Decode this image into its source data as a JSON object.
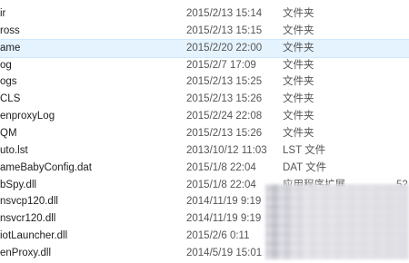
{
  "file_list": {
    "rows": [
      {
        "name": "ir",
        "date": "2015/2/13 15:14",
        "type": "文件夹",
        "size": "",
        "selected": false
      },
      {
        "name": "ross",
        "date": "2015/2/13 15:15",
        "type": "文件夹",
        "size": "",
        "selected": false
      },
      {
        "name": "ame",
        "date": "2015/2/20 22:00",
        "type": "文件夹",
        "size": "",
        "selected": true
      },
      {
        "name": "og",
        "date": "2015/2/7 17:09",
        "type": "文件夹",
        "size": "",
        "selected": false
      },
      {
        "name": "ogs",
        "date": "2015/2/13 15:25",
        "type": "文件夹",
        "size": "",
        "selected": false
      },
      {
        "name": "CLS",
        "date": "2015/2/13 15:26",
        "type": "文件夹",
        "size": "",
        "selected": false
      },
      {
        "name": "enproxyLog",
        "date": "2015/2/24 22:08",
        "type": "文件夹",
        "size": "",
        "selected": false
      },
      {
        "name": "QM",
        "date": "2015/2/13 15:26",
        "type": "文件夹",
        "size": "",
        "selected": false
      },
      {
        "name": "uto.lst",
        "date": "2013/10/12 11:03",
        "type": "LST 文件",
        "size": "",
        "selected": false
      },
      {
        "name": "ameBabyConfig.dat",
        "date": "2015/1/8 22:04",
        "type": "DAT 文件",
        "size": "",
        "selected": false
      },
      {
        "name": "bSpy.dll",
        "date": "2015/1/8 22:04",
        "type": "应用程序扩展",
        "size": "52",
        "selected": false
      },
      {
        "name": "nsvcp120.dll",
        "date": "2014/11/19 9:19",
        "type": "",
        "size": "",
        "selected": false
      },
      {
        "name": "nsvcr120.dll",
        "date": "2014/11/19 9:19",
        "type": "",
        "size": "",
        "selected": false
      },
      {
        "name": "iotLauncher.dll",
        "date": "2015/2/6 0:11",
        "type": "",
        "size": "",
        "selected": false
      },
      {
        "name": "enProxy.dll",
        "date": "2014/5/19 15:01",
        "type": "",
        "size": "",
        "selected": false
      }
    ]
  }
}
